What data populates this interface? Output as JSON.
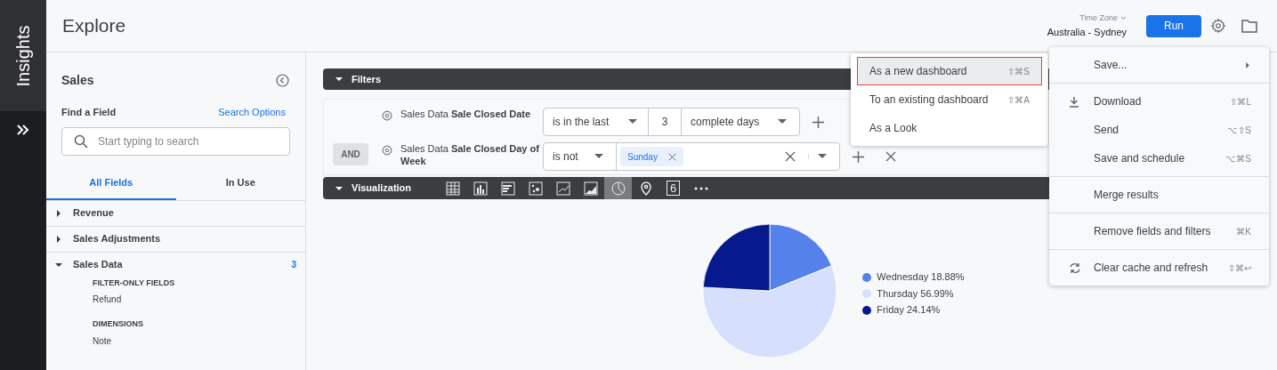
{
  "rail": {
    "label": "Insights"
  },
  "header": {
    "title": "Explore",
    "time_zone_label": "Time Zone",
    "time_zone": "Australia - Sydney",
    "run_button": "Run"
  },
  "sidebar": {
    "title": "Sales",
    "find_label": "Find a Field",
    "search_options": "Search Options",
    "search": {
      "placeholder": "Start typing to search"
    },
    "tabs": [
      {
        "label": "All Fields",
        "selected": true
      },
      {
        "label": "In Use",
        "selected": false
      }
    ],
    "tree": [
      {
        "label": "Revenue",
        "expanded": false
      },
      {
        "label": "Sales Adjustments",
        "expanded": false
      },
      {
        "label": "Sales Data",
        "expanded": true,
        "count": "3",
        "children": [
          {
            "heading": "FILTER-ONLY FIELDS",
            "items": [
              "Refund"
            ]
          },
          {
            "heading": "DIMENSIONS",
            "items": [
              "Note"
            ]
          }
        ]
      }
    ]
  },
  "filters": {
    "title": "Filters",
    "conjunction": "AND",
    "rows": [
      {
        "kind": "range",
        "field": "Sales Data **Sale Closed Date**",
        "operator": "is in the last",
        "value": "3",
        "unit": "complete days"
      },
      {
        "kind": "tags",
        "field": "Sales Data **Sale Closed Day of Week**",
        "operator": "is not",
        "tags": [
          "Sunday"
        ]
      }
    ]
  },
  "visualization": {
    "title": "Visualization",
    "types": [
      {
        "kind": "table",
        "selected": false
      },
      {
        "kind": "column",
        "selected": false
      },
      {
        "kind": "bar",
        "selected": false
      },
      {
        "kind": "scatter",
        "selected": false
      },
      {
        "kind": "line",
        "selected": false
      },
      {
        "kind": "area",
        "selected": false
      },
      {
        "kind": "pie",
        "selected": true
      },
      {
        "kind": "map",
        "selected": false
      },
      {
        "kind": "single",
        "label": "6",
        "selected": false
      },
      {
        "kind": "more",
        "selected": false
      }
    ],
    "chart_data": {
      "type": "pie",
      "categories": [
        "Wednesday",
        "Thursday",
        "Friday"
      ],
      "values": [
        18.88,
        56.99,
        24.14
      ],
      "colors": [
        "#5582ea",
        "#d6e0fc",
        "#061a8e"
      ],
      "value_labels": [
        "18.88%",
        "56.99%",
        "24.14%"
      ],
      "legend": "right"
    }
  },
  "menu": {
    "sections": [
      [
        {
          "kind": "submenu",
          "label": "Save..."
        }
      ],
      [
        {
          "kind": "download",
          "label": "Download",
          "shortcut": "⇧⌘L"
        },
        {
          "kind": "plain",
          "label": "Send",
          "shortcut": "⌥⇧S"
        },
        {
          "kind": "plain",
          "label": "Save and schedule",
          "shortcut": "⌥⌘S"
        }
      ],
      [
        {
          "kind": "plain",
          "label": "Merge results"
        }
      ],
      [
        {
          "kind": "plain",
          "label": "Remove fields and filters",
          "shortcut": "⌘K"
        }
      ],
      [
        {
          "kind": "refresh",
          "label": "Clear cache and refresh",
          "shortcut": "⇧⌘↩"
        }
      ]
    ]
  },
  "submenu": {
    "items": [
      {
        "label": "As a new dashboard",
        "shortcut": "⇧⌘S",
        "selected": true
      },
      {
        "label": "To an existing dashboard",
        "shortcut": "⇧⌘A",
        "selected": false
      },
      {
        "label": "As a Look",
        "selected": false
      }
    ]
  }
}
